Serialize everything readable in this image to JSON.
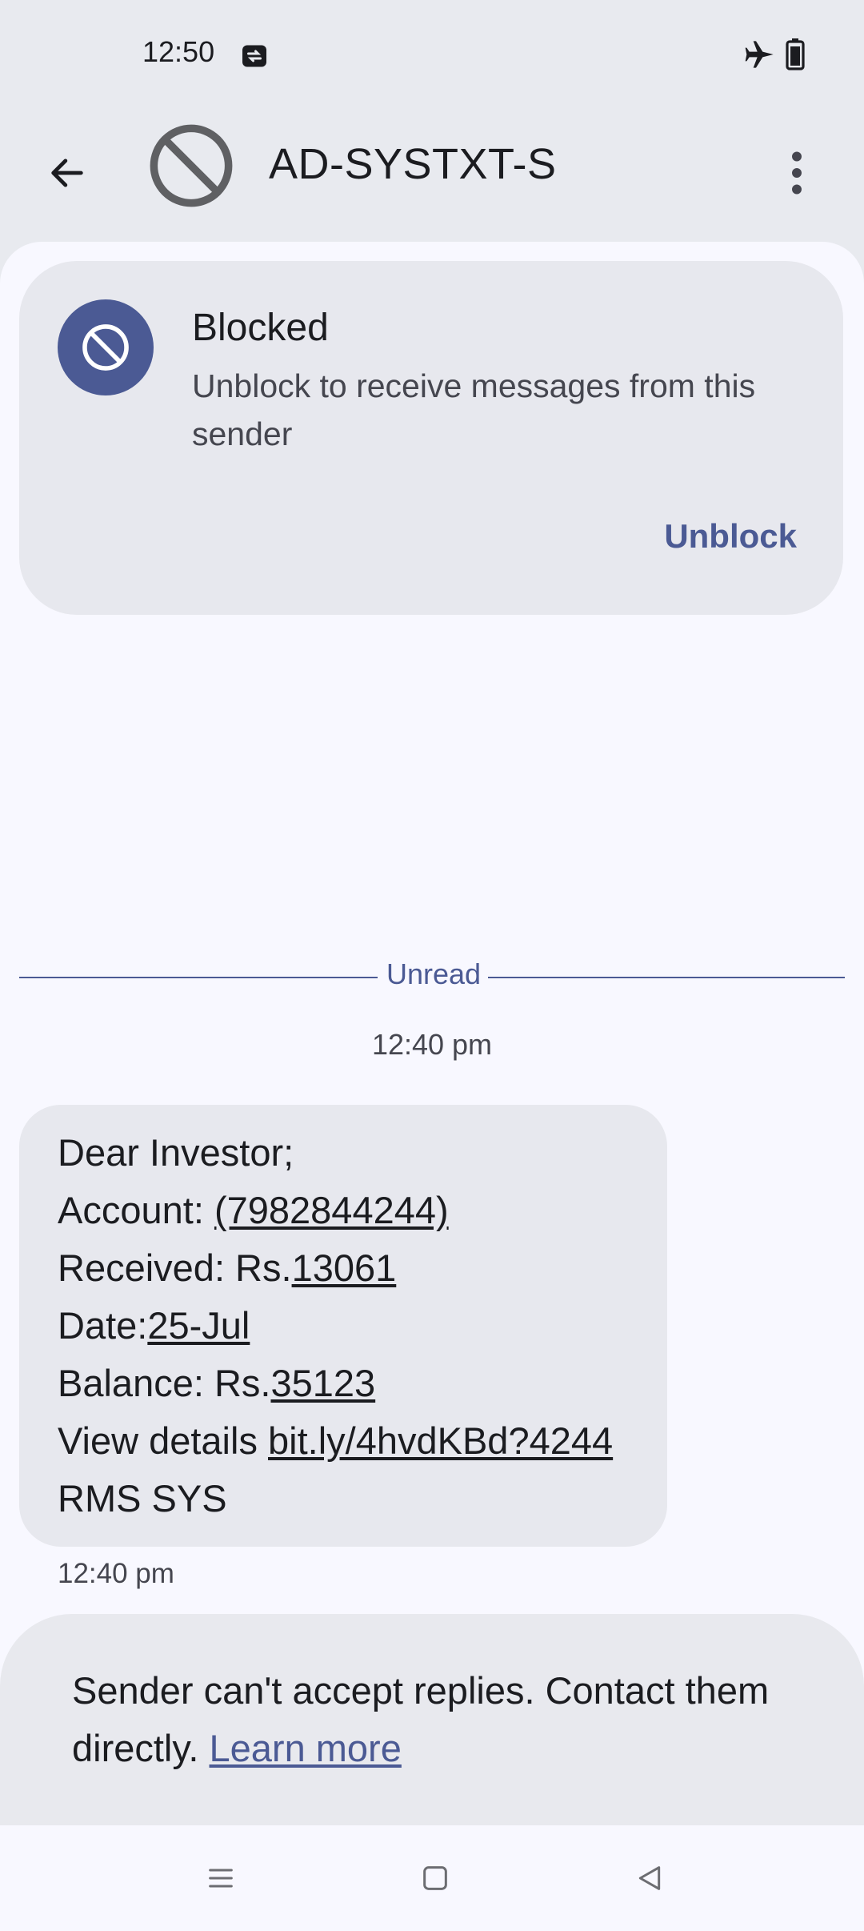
{
  "status_bar": {
    "time": "12:50",
    "icons": [
      "data-saver-icon",
      "airplane-icon",
      "battery-icon"
    ]
  },
  "header": {
    "title": "AD-SYSTXT-S",
    "back_icon": "arrow-left-icon",
    "avatar_icon": "blocked-avatar-icon",
    "menu_icon": "more-vertical-icon"
  },
  "blocked_card": {
    "title": "Blocked",
    "description": "Unblock to receive messages from this sender",
    "button_label": "Unblock",
    "icon": "block-icon"
  },
  "unread_label": "Unread",
  "timestamp_header": "12:40 pm",
  "message": {
    "greeting": "Dear Investor;",
    "account_label": "Account: ",
    "account_value": "(7982844244)",
    "received_label": "Received: Rs.",
    "received_value": "13061",
    "date_label": "Date:",
    "date_value": "25-Jul",
    "balance_label": "Balance: Rs.",
    "balance_value": "35123",
    "details_label": "View details ",
    "details_link": "bit.ly/4hvdKBd?4244",
    "signature": "RMS SYS",
    "time": "12:40 pm"
  },
  "reply_notice": {
    "text": "Sender can't accept replies. Contact them directly. ",
    "link": "Learn more"
  },
  "nav_bar": {
    "icons": [
      "recents-icon",
      "home-icon",
      "back-triangle-icon"
    ]
  },
  "colors": {
    "accent": "#4b5a94",
    "background": "#f8f8ff",
    "surface": "#e7e8ee"
  }
}
